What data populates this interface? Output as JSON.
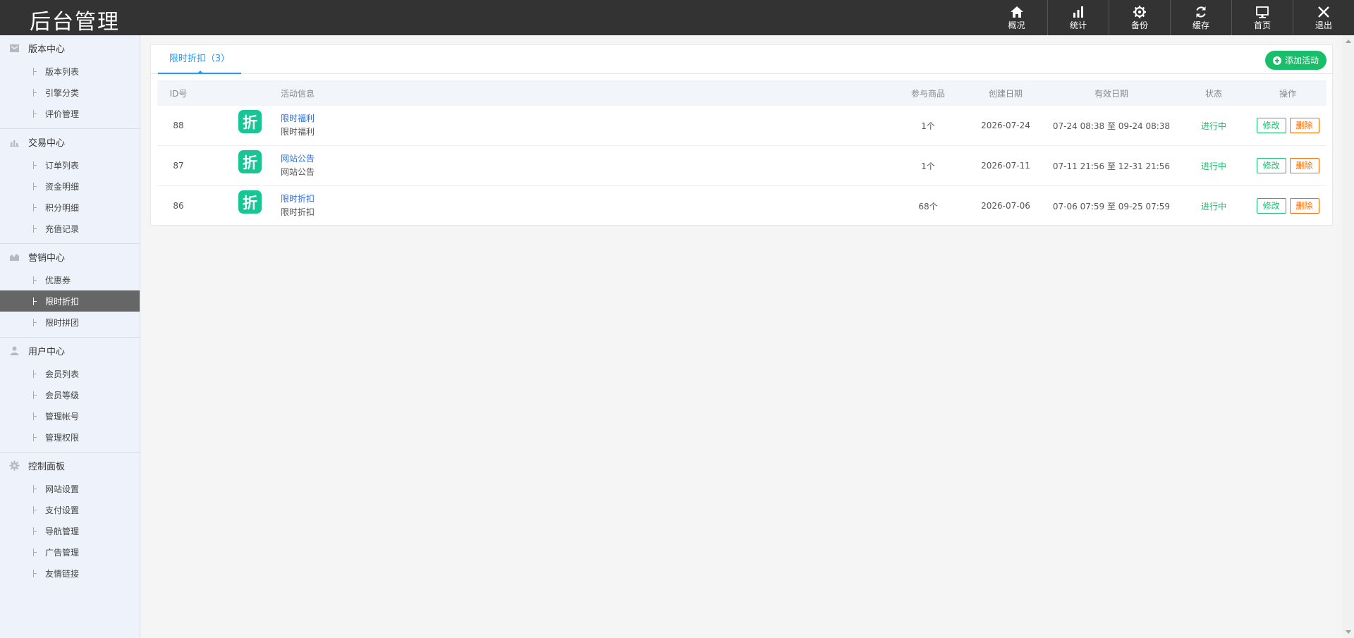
{
  "app": {
    "logo": "后台管理"
  },
  "topnav": [
    {
      "icon": "home-icon",
      "label": "概况"
    },
    {
      "icon": "bar-chart-icon",
      "label": "统计"
    },
    {
      "icon": "gear-icon",
      "label": "备份"
    },
    {
      "icon": "refresh-icon",
      "label": "缓存"
    },
    {
      "icon": "monitor-icon",
      "label": "首页"
    },
    {
      "icon": "close-icon",
      "label": "退出"
    }
  ],
  "sidebar": {
    "groups": [
      {
        "icon": "inbox-icon",
        "title": "版本中心",
        "items": [
          "版本列表",
          "引擎分类",
          "评价管理"
        ]
      },
      {
        "icon": "bar-chart-icon",
        "title": "交易中心",
        "items": [
          "订单列表",
          "资金明细",
          "积分明细",
          "充值记录"
        ]
      },
      {
        "icon": "area-chart-icon",
        "title": "营销中心",
        "items": [
          "优惠券",
          "限时折扣",
          "限时拼团"
        ]
      },
      {
        "icon": "user-icon",
        "title": "用户中心",
        "items": [
          "会员列表",
          "会员等级",
          "管理帐号",
          "管理权限"
        ]
      },
      {
        "icon": "gear-icon",
        "title": "控制面板",
        "items": [
          "网站设置",
          "支付设置",
          "导航管理",
          "广告管理",
          "友情链接"
        ]
      }
    ],
    "active_item": "限时折扣"
  },
  "main": {
    "tab_label": "限时折扣（3）",
    "add_button": "添加活动",
    "columns": [
      "ID号",
      "活动信息",
      "参与商品",
      "创建日期",
      "有效日期",
      "状态",
      "操作"
    ],
    "rows": [
      {
        "id": "88",
        "badge": "折",
        "title": "限时福利",
        "subtitle": "限时福利",
        "goods": "1个",
        "created": "2026-07-24",
        "valid": "07-24 08:38 至 09-24 08:38",
        "status": "进行中",
        "edit": "修改",
        "delete": "删除"
      },
      {
        "id": "87",
        "badge": "折",
        "title": "网站公告",
        "subtitle": "网站公告",
        "goods": "1个",
        "created": "2026-07-11",
        "valid": "07-11 21:56 至 12-31 21:56",
        "status": "进行中",
        "edit": "修改",
        "delete": "删除"
      },
      {
        "id": "86",
        "badge": "折",
        "title": "限时折扣",
        "subtitle": "限时折扣",
        "goods": "68个",
        "created": "2026-07-06",
        "valid": "07-06 07:59 至 09-25 07:59",
        "status": "进行中",
        "edit": "修改",
        "delete": "删除"
      }
    ]
  },
  "colors": {
    "topbar": "#333333",
    "sidebar_bg": "#eef3fb",
    "active_item_bg": "#666666",
    "tab_accent": "#1e9fff",
    "add_button": "#19be6b",
    "status_green": "#19be6b",
    "delete_orange": "#ff6a00",
    "badge_teal": "#17c595"
  }
}
